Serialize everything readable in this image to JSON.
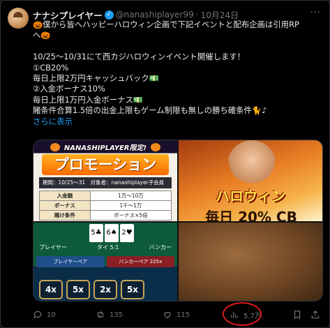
{
  "author": {
    "display_name": "ナナシプレイヤー",
    "handle": "@nanashiplayer99",
    "separator": "·",
    "date": "10月24日",
    "verified_mark": "✓"
  },
  "more_menu": "···",
  "tweet_lines": [
    "🎃僕から皆へハッピーハロウィン企画で下記イベントと配布企画は引用RP",
    "へ🎃",
    "",
    "10/25〜10/31にて西カジハロウィンイベント開催します！",
    "①CB20%",
    "毎日上限2万円キャッシュバック💵",
    "②入金ボーナス10%",
    "毎日上限1万円入金ボーナス💵",
    "賭条件合算1.5倍の出金上限もゲーム制限も無しの勝ち確条件🐈♪"
  ],
  "show_more": "さらに表示",
  "media": {
    "promo": {
      "brand": "NANASHIPLAYER限定!",
      "title": "プロモーション",
      "info": "期間：10/25〜31　対象者：nanashiplayer子会員",
      "rows": [
        {
          "k": "入金額",
          "v": "1万〜10万"
        },
        {
          "k": "ボーナス",
          "v": "1千〜1万"
        },
        {
          "k": "賭け条件",
          "v": "ボーナス×5倍"
        }
      ]
    },
    "halloween": {
      "title": "ハロウィン",
      "subtitle": "毎日 20% CB"
    },
    "baccarat": {
      "cards": [
        "5♣",
        "6♠",
        "2♥"
      ],
      "labels": [
        "プレイヤー",
        "タイ 5:1",
        "バンカー"
      ],
      "bets": [
        "プレイヤーペア",
        "バンカーペア 225x"
      ],
      "multipliers": [
        "4x",
        "5x",
        "2x",
        "5x"
      ]
    }
  },
  "actions": {
    "reply_count": "10",
    "retweet_count": "135",
    "like_count": "115",
    "views_count": "5.7万"
  },
  "colors": {
    "accent": "#1d9bf0",
    "muted": "#71767b",
    "highlight_circle": "#e0191f"
  }
}
